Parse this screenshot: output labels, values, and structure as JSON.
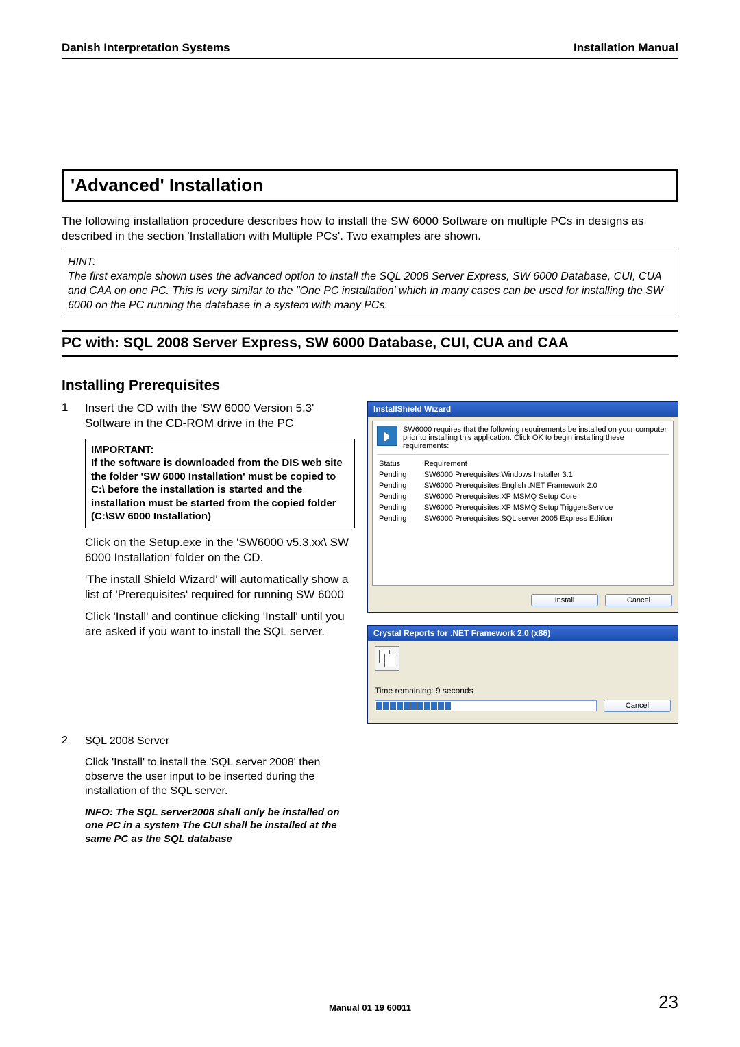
{
  "header": {
    "left": "Danish Interpretation Systems",
    "right": "Installation Manual"
  },
  "section_title": "'Advanced' Installation",
  "intro_paragraph": "The following installation procedure describes how to install the SW 6000 Software on multiple PCs in designs as described in the section 'Installation with Multiple PCs'. Two examples are shown.",
  "hint": {
    "label": "HINT:",
    "text": "The first example shown uses the advanced option to install the SQL 2008 Server Express, SW 6000 Database, CUI, CUA and CAA on one PC. This is very similar to the \"One PC installation' which in many cases can be used for installing the SW 6000 on the PC running the database in a system with many PCs."
  },
  "sub_section_title": "PC with: SQL 2008 Server Express, SW 6000 Database, CUI, CUA and CAA",
  "sub_heading": "Installing Prerequisites",
  "steps": [
    {
      "num": "1",
      "p1": "Insert the CD with the 'SW 6000 Version 5.3' Software in the CD-ROM drive in the PC",
      "important_label": "IMPORTANT:",
      "important_text": "If the software is downloaded from the DIS web site the folder 'SW 6000 Installation' must be copied to C:\\ before the installation is started and the installation must be started from the copied folder (C:\\SW 6000 Installation)",
      "p2": "Click on the Setup.exe in the 'SW6000 v5.3.xx\\ SW 6000 Installation' folder on the CD.",
      "p3": "'The install Shield Wizard' will automatically show a list of 'Prerequisites' required for running SW 6000",
      "p4": "Click 'Install' and continue clicking 'Install' until you are asked if you want to install the SQL server."
    },
    {
      "num": "2",
      "p1": "SQL 2008 Server",
      "p2": "Click 'Install' to install the 'SQL server 2008' then observe the user input to be inserted during the installation of the SQL server.",
      "info": "INFO: The SQL server2008 shall only be installed on one PC in a system The CUI shall be installed at the same PC as the SQL database"
    }
  ],
  "dialog1": {
    "title": "InstallShield Wizard",
    "msg": "SW6000 requires that the following requirements be installed on your computer prior to installing this application. Click OK to begin installing these requirements:",
    "cols": {
      "status": "Status",
      "req": "Requirement"
    },
    "rows": [
      {
        "status": "Pending",
        "req": "SW6000 Prerequisites:Windows Installer 3.1"
      },
      {
        "status": "Pending",
        "req": "SW6000 Prerequisites:English .NET Framework 2.0"
      },
      {
        "status": "Pending",
        "req": "SW6000 Prerequisites:XP MSMQ Setup Core"
      },
      {
        "status": "Pending",
        "req": "SW6000 Prerequisites:XP MSMQ Setup TriggersService"
      },
      {
        "status": "Pending",
        "req": "SW6000 Prerequisites:SQL server 2005 Express Edition"
      }
    ],
    "buttons": {
      "install": "Install",
      "cancel": "Cancel"
    }
  },
  "dialog2": {
    "title": "Crystal Reports for .NET Framework 2.0 (x86)",
    "time": "Time remaining: 9 seconds",
    "cancel": "Cancel",
    "progress_segments": 11
  },
  "footer": {
    "manual_ref": "Manual 01 19 60011",
    "page_number": "23"
  }
}
